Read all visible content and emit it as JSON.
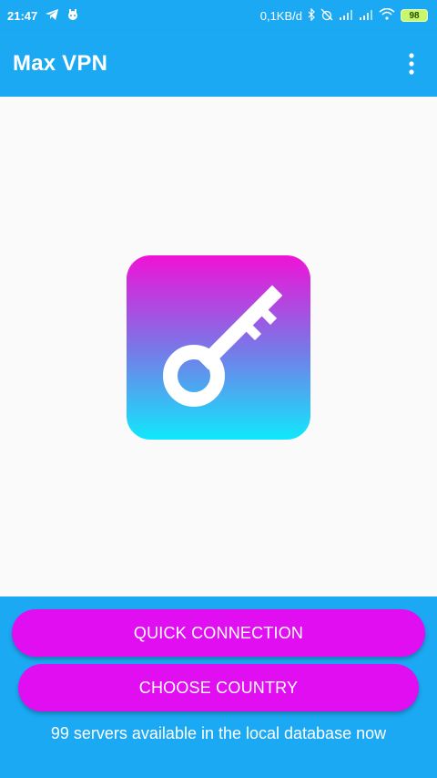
{
  "status_bar": {
    "time": "21:47",
    "left_icons": [
      "telegram-icon",
      "android-robot-icon"
    ],
    "speed": "0,1KB/d",
    "right_icons": [
      "bluetooth-icon",
      "alarm-off-icon",
      "signal-icon",
      "signal-icon",
      "wifi-icon"
    ],
    "battery": "98"
  },
  "app_bar": {
    "title": "Max VPN",
    "menu_icon": "more-vertical-icon"
  },
  "logo": {
    "icon": "key-icon",
    "gradient_top": "#f012d6",
    "gradient_bottom": "#10e8fb"
  },
  "actions": {
    "quick_connection": "QUICK CONNECTION",
    "choose_country": "CHOOSE COUNTRY"
  },
  "footer": {
    "servers_text": "99 servers available in the local database now"
  },
  "colors": {
    "primary": "#1ca9f4",
    "accent": "#e10ef2",
    "background": "#fafafa"
  }
}
